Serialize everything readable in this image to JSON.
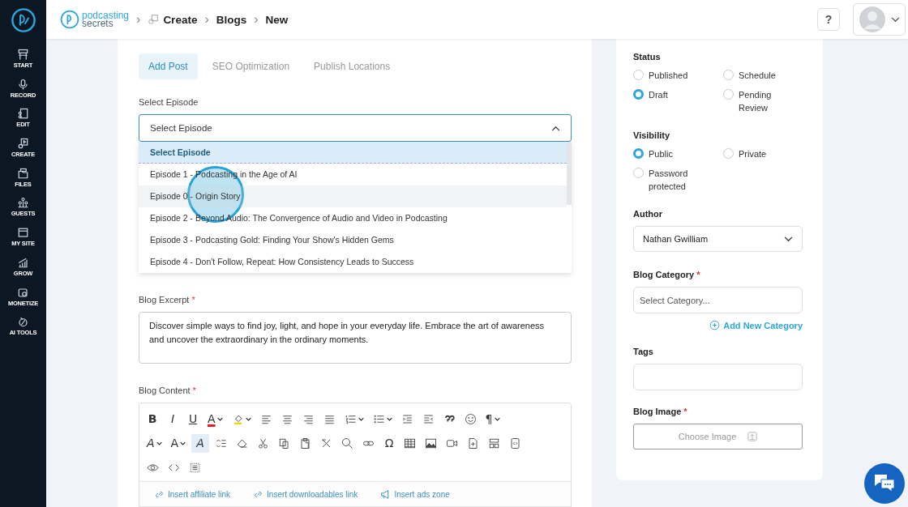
{
  "sidebar": {
    "items": [
      {
        "label": "START"
      },
      {
        "label": "RECORD"
      },
      {
        "label": "EDIT"
      },
      {
        "label": "CREATE"
      },
      {
        "label": "FILES"
      },
      {
        "label": "GUESTS"
      },
      {
        "label": "MY SITE"
      },
      {
        "label": "GROW"
      },
      {
        "label": "MONETIZE"
      },
      {
        "label": "AI TOOLS"
      }
    ]
  },
  "header": {
    "brand": [
      "podcasting",
      "secrets"
    ],
    "separators": [
      "›",
      "›",
      "›"
    ],
    "breadcrumb": [
      "Create",
      "Blogs",
      "New"
    ],
    "help": "?"
  },
  "tabs": [
    {
      "label": "Add Post",
      "selected": true
    },
    {
      "label": "SEO Optimization",
      "selected": false
    },
    {
      "label": "Publish Locations",
      "selected": false
    }
  ],
  "episode": {
    "label": "Select Episode",
    "value": "Select Episode",
    "expanded": true,
    "options": [
      {
        "label": "Select Episode",
        "selected": true,
        "hovered": false
      },
      {
        "label": "Episode 1 - Podcasting in the Age of AI",
        "selected": false,
        "hovered": false
      },
      {
        "label": "Episode 0 - Origin Story",
        "selected": false,
        "hovered": true
      },
      {
        "label": "Episode 2 - Beyond Audio: The Convergence of Audio and Video in Podcasting",
        "selected": false,
        "hovered": false
      },
      {
        "label": "Episode 3 - Podcasting Gold: Finding Your Show's Hidden Gems",
        "selected": false,
        "hovered": false
      },
      {
        "label": "Episode 4 - Don't Follow, Repeat: How Consistency Leads to Success",
        "selected": false,
        "hovered": false
      }
    ]
  },
  "excerpt": {
    "label": "Blog Excerpt",
    "required": "*",
    "value": "Discover simple ways to find joy, light, and hope in your everyday life. Embrace the art of awareness and uncover the extraordinary in the ordinary moments."
  },
  "content": {
    "label": "Blog Content",
    "required": "*",
    "toolbar": [
      {
        "kind": "glyph",
        "text": "B",
        "menu": false,
        "active": false
      },
      {
        "kind": "glyph",
        "text": "I",
        "menu": false,
        "active": false
      },
      {
        "kind": "glyph",
        "text": "U",
        "menu": false,
        "active": false
      },
      {
        "kind": "glyph",
        "text": "A",
        "menu": true,
        "active": false
      },
      {
        "kind": "icon",
        "menu": true,
        "active": false
      },
      {
        "kind": "icon",
        "menu": false,
        "active": false
      },
      {
        "kind": "icon",
        "menu": false,
        "active": false
      },
      {
        "kind": "icon",
        "menu": false,
        "active": false
      },
      {
        "kind": "icon",
        "menu": false,
        "active": false
      },
      {
        "kind": "icon",
        "menu": true,
        "active": false
      },
      {
        "kind": "icon",
        "menu": true,
        "active": false
      },
      {
        "kind": "icon",
        "menu": false,
        "active": false
      },
      {
        "kind": "icon",
        "menu": false,
        "active": false
      },
      {
        "kind": "icon",
        "menu": false,
        "active": false
      },
      {
        "kind": "icon",
        "menu": false,
        "active": false
      },
      {
        "kind": "glyph",
        "text": "¶",
        "menu": true,
        "active": false
      },
      {
        "kind": "glyph",
        "text": "A",
        "menu": true,
        "active": false
      },
      {
        "kind": "glyph",
        "text": "A",
        "menu": true,
        "active": false
      },
      {
        "kind": "glyph",
        "text": "A",
        "menu": false,
        "active": true
      },
      {
        "kind": "icon",
        "menu": false,
        "active": false
      },
      {
        "kind": "icon",
        "menu": false,
        "active": false
      },
      {
        "kind": "icon",
        "menu": false,
        "active": false
      },
      {
        "kind": "icon",
        "menu": false,
        "active": false
      },
      {
        "kind": "icon",
        "menu": false,
        "active": false
      },
      {
        "kind": "icon",
        "menu": false,
        "active": false
      },
      {
        "kind": "icon",
        "menu": false,
        "active": false
      },
      {
        "kind": "icon",
        "menu": false,
        "active": false
      },
      {
        "kind": "glyph",
        "text": "Ω",
        "menu": false,
        "active": false
      },
      {
        "kind": "icon",
        "menu": false,
        "active": false
      },
      {
        "kind": "icon",
        "menu": false,
        "active": false
      },
      {
        "kind": "icon",
        "menu": false,
        "active": false
      },
      {
        "kind": "icon",
        "menu": false,
        "active": false
      },
      {
        "kind": "icon",
        "menu": false,
        "active": false
      },
      {
        "kind": "icon",
        "menu": false,
        "active": false
      },
      {
        "kind": "icon",
        "menu": false,
        "active": false
      },
      {
        "kind": "icon",
        "menu": false,
        "active": false
      },
      {
        "kind": "icon",
        "menu": false,
        "active": false
      }
    ],
    "inserts": [
      {
        "label": "Insert affiliate link",
        "kind": "link"
      },
      {
        "label": "Insert downloadables link",
        "kind": "link"
      },
      {
        "label": "Insert ads zone",
        "kind": "ads"
      }
    ]
  },
  "status": {
    "label": "Status",
    "options": [
      {
        "label": "Published",
        "selected": false
      },
      {
        "label": "Schedule",
        "selected": false
      },
      {
        "label": "Draft",
        "selected": true
      },
      {
        "label": "Pending Review",
        "selected": false
      }
    ]
  },
  "visibility": {
    "label": "Visibility",
    "options": [
      {
        "label": "Public",
        "selected": true
      },
      {
        "label": "Private",
        "selected": false
      },
      {
        "label": "Password protected",
        "selected": false
      }
    ]
  },
  "author": {
    "label": "Author",
    "value": "Nathan Gwilliam"
  },
  "category": {
    "label": "Blog Category",
    "required": "*",
    "placeholder": "Select Category...",
    "add": "Add New Category"
  },
  "tags": {
    "label": "Tags"
  },
  "image": {
    "label": "Blog Image",
    "required": "*",
    "button": "Choose Image"
  }
}
